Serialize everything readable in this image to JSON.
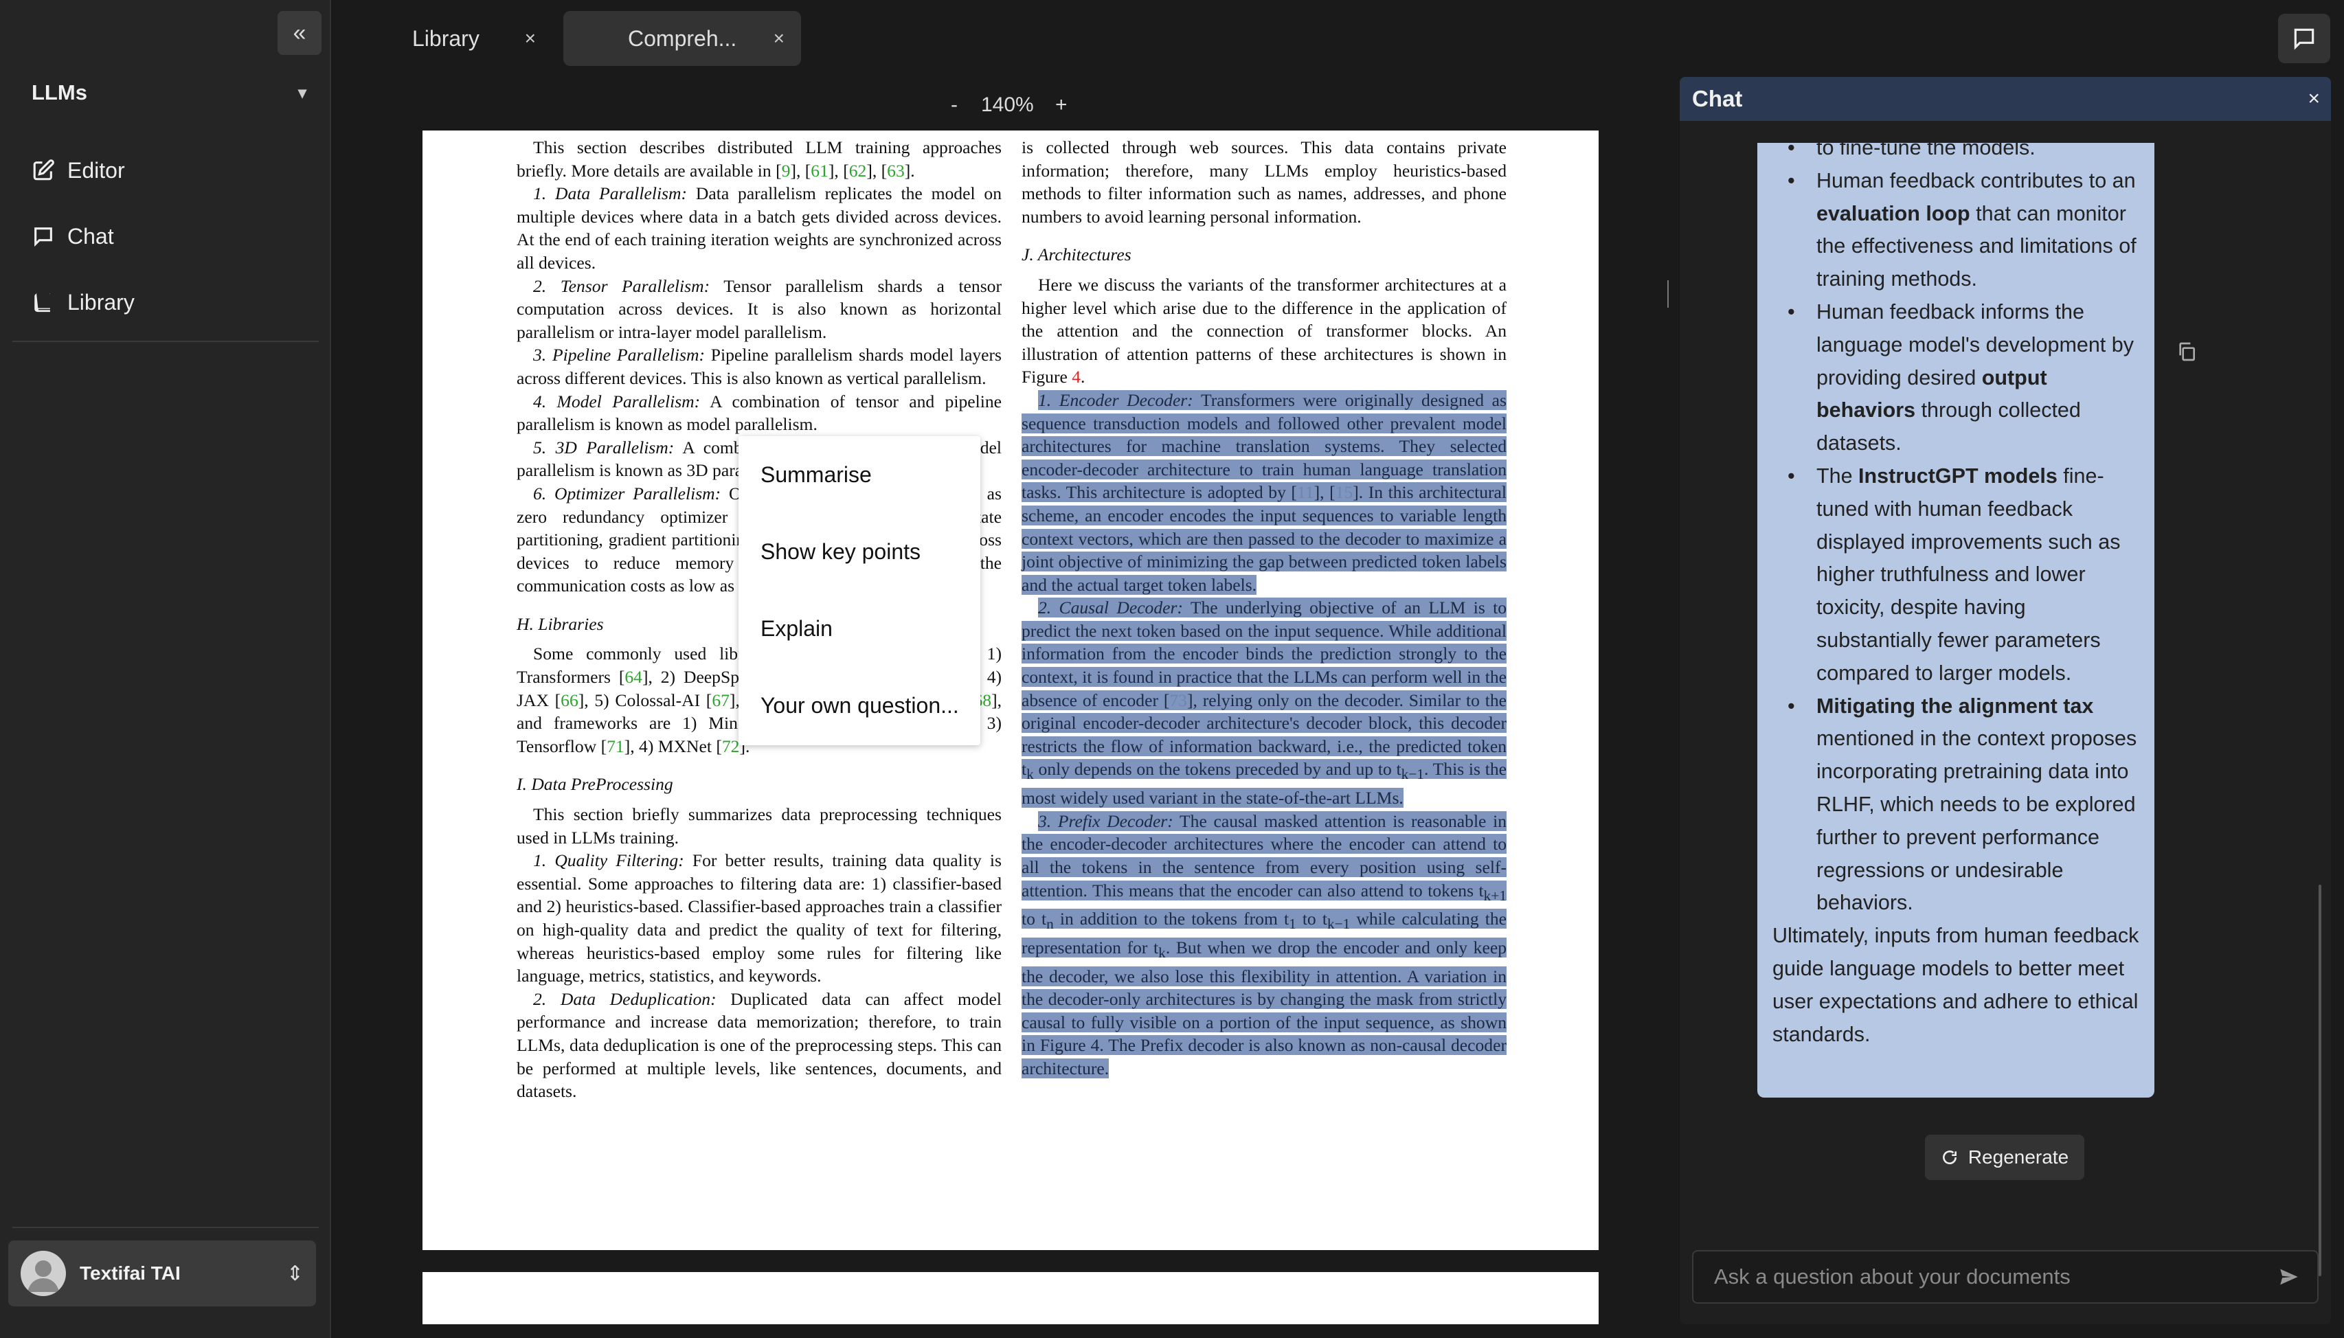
{
  "sidebar": {
    "collapse_icon": "chevrons-left-icon",
    "workspace": "LLMs",
    "items": [
      {
        "label": "Editor",
        "icon": "edit-icon"
      },
      {
        "label": "Chat",
        "icon": "chat-bubble-icon"
      },
      {
        "label": "Library",
        "icon": "book-icon"
      }
    ],
    "user_name": "Textifai TAI"
  },
  "tabs": [
    {
      "label": "Library",
      "close": "×"
    },
    {
      "label": "Compreh...",
      "close": "×"
    }
  ],
  "zoom": {
    "minus": "-",
    "value": "140%",
    "plus": "+"
  },
  "document": {
    "left": [
      {
        "type": "p",
        "html": "This section describes distributed LLM training approaches briefly. More details are available in [<span class='ref'>9</span>], [<span class='ref'>61</span>], [<span class='ref'>62</span>], [<span class='ref'>63</span>]."
      },
      {
        "type": "p",
        "html": "<span class='it'>1. Data Parallelism:</span> Data parallelism replicates the model on multiple devices where data in a batch gets divided across devices. At the end of each training iteration weights are synchronized across all devices."
      },
      {
        "type": "p",
        "html": "<span class='it'>2. Tensor Parallelism:</span> Tensor parallelism shards a tensor computation across devices. It is also known as horizontal parallelism or intra-layer model parallelism."
      },
      {
        "type": "p",
        "html": "<span class='it'>3. Pipeline Parallelism:</span> Pipeline parallelism shards model layers across different devices. This is also known as vertical parallelism."
      },
      {
        "type": "p",
        "html": "<span class='it'>4. Model Parallelism:</span> A combination of tensor and pipeline parallelism is known as model parallelism."
      },
      {
        "type": "p",
        "html": "<span class='it'>5. 3D Parallelism:</span> A combination of data, tensor, and model parallelism is known as 3D parallelism."
      },
      {
        "type": "p",
        "html": "<span class='it'>6. Optimizer Parallelism:</span> Optimizer parallelism also known as zero redundancy optimizer [<span class='ref'>37</span>] implements optimizer state partitioning, gradient partitioning, and parameter partitioning across devices to reduce memory consumption while keeping the communication costs as low as possible."
      },
      {
        "type": "h",
        "html": "H. Libraries"
      },
      {
        "type": "p",
        "html": "Some commonly used libraries for LLMs training are: 1) Transformers [<span class='ref'>64</span>], 2) DeepSpeed [<span class='ref'>65</span>], 3) Megatron-LM [<span class='ref'>62</span>], 4) JAX [<span class='ref'>66</span>], 5) Colossal-AI [<span class='ref'>67</span>], 6) BMTrain [<span class='ref'>63</span>], 7) FastMoE [<span class='ref'>68</span>], and frameworks are 1) MindSpore [<span class='ref'>69</span>], 2) PyTorch [<span class='ref'>70</span>], 3) Tensorflow [<span class='ref'>71</span>], 4) MXNet [<span class='ref'>72</span>]."
      },
      {
        "type": "h",
        "html": "I. Data PreProcessing"
      },
      {
        "type": "p",
        "html": "This section briefly summarizes data preprocessing techniques used in LLMs training."
      },
      {
        "type": "p",
        "html": "<span class='it'>1. Quality Filtering:</span> For better results, training data quality is essential. Some approaches to filtering data are: 1) classifier-based and 2) heuristics-based. Classifier-based approaches train a classifier on high-quality data and predict the quality of text for filtering, whereas heuristics-based employ some rules for filtering like language, metrics, statistics, and keywords."
      },
      {
        "type": "p",
        "html": "<span class='it'>2. Data Deduplication:</span> Duplicated data can affect model performance and increase data memorization; therefore, to train LLMs, data deduplication is one of the preprocessing steps. This can be performed at multiple levels, like sentences, documents, and datasets."
      }
    ],
    "right": [
      {
        "type": "p0",
        "html": "is collected through web sources. This data contains private information; therefore, many LLMs employ heuristics-based methods to filter information such as names, addresses, and phone numbers to avoid learning personal information."
      },
      {
        "type": "h",
        "html": "J. Architectures"
      },
      {
        "type": "p",
        "html": "Here we discuss the variants of the transformer architectures at a higher level which arise due to the difference in the application of the attention and the connection of transformer blocks. An illustration of attention patterns of these architectures is shown in Figure <span class='red'>4</span>."
      },
      {
        "type": "p",
        "html": "<span class='sel'><span class='it'>1. Encoder Decoder:</span> Transformers were originally designed as sequence transduction models and followed other prevalent model architectures for machine translation systems. They selected encoder-decoder architecture to train human language translation tasks. This architecture is adopted by [<span class='ref'>11</span>], [<span class='ref'>15</span>]. In this architectural scheme, an encoder encodes the input sequences to variable length context vectors, which are then passed to the decoder to maximize a joint objective of minimizing the gap between predicted token labels and the actual target token labels.</span>"
      },
      {
        "type": "p",
        "html": "<span class='sel'><span class='it'>2. Causal Decoder:</span> The underlying objective of an LLM is to predict the next token based on the input sequence. While additional information from the encoder binds the prediction strongly to the context, it is found in practice that the LLMs can perform well in the absence of encoder [<span class='ref'>73</span>], relying only on the decoder. Similar to the original encoder-decoder architecture's decoder block, this decoder restricts the flow of information backward, i.e., the predicted token t<sub>k</sub> only depends on the tokens preceded by and up to t<sub>k−1</sub>. This is the most widely used variant in the state-of-the-art LLMs.</span>"
      },
      {
        "type": "p",
        "html": "<span class='sel'><span class='it'>3. Prefix Decoder:</span> The causal masked attention is reasonable in the encoder-decoder architectures where the encoder can attend to all the tokens in the sentence from every position using self-attention. This means that the encoder can also attend to tokens t<sub>k+1</sub> to t<sub>n</sub> in addition to the tokens from t<sub>1</sub> to t<sub>k−1</sub> while calculating the representation for t<sub>k</sub>. But when we drop the encoder and only keep the decoder, we also lose this flexibility in attention. A variation in the decoder-only architectures is by changing the mask from strictly causal to fully visible on a portion of the input sequence, as shown in Figure 4. The Prefix decoder is also known as non-causal decoder architecture.</span>"
      }
    ]
  },
  "context_menu": [
    "Summarise",
    "Show key points",
    "Explain",
    "Your own question..."
  ],
  "chat": {
    "title": "Chat",
    "close": "×",
    "toggle_icon": "chat-bubble-icon",
    "message_html": "<ul><li>to fine-tune the models.</li><li>Human feedback contributes to an <b>evaluation loop</b> that can monitor the effectiveness and limitations of training methods.</li><li>Human feedback informs the language model's development by providing desired <b>output behaviors</b> through collected datasets.</li><li>The <b>InstructGPT models</b> fine-tuned with human feedback displayed improvements such as higher truthfulness and lower toxicity, despite having substantially fewer parameters compared to larger models.</li><li><b>Mitigating the alignment tax</b> mentioned in the context proposes incorporating pretraining data into RLHF, which needs to be explored further to prevent performance regressions or undesirable behaviors.</li></ul><div>Ultimately, inputs from human feedback guide language models to better meet user expectations and adhere to ethical standards.</div>",
    "regenerate": "Regenerate",
    "input_placeholder": "Ask a question about your documents",
    "send_icon": "send-icon"
  }
}
